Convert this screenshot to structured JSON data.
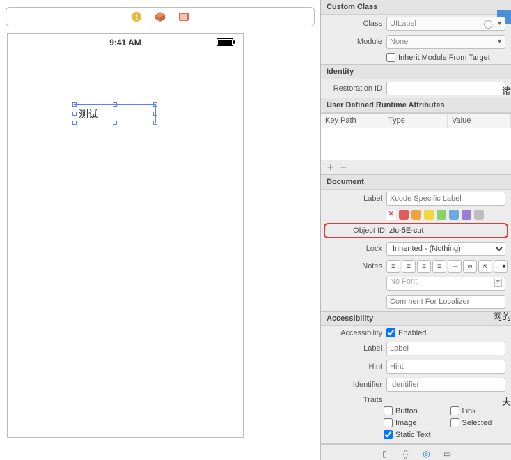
{
  "canvas": {
    "device_time": "9:41 AM",
    "selected_label_text": "测试"
  },
  "custom_class": {
    "header": "Custom Class",
    "class_label": "Class",
    "class_value": "UILabel",
    "module_label": "Module",
    "module_value": "None",
    "inherit_label": "Inherit Module From Target",
    "inherit_checked": false
  },
  "identity": {
    "header": "Identity",
    "restoration_label": "Restoration ID",
    "restoration_value": ""
  },
  "runtime_attrs": {
    "header": "User Defined Runtime Attributes",
    "columns": [
      "Key Path",
      "Type",
      "Value"
    ],
    "rows": []
  },
  "document": {
    "header": "Document",
    "label_label": "Label",
    "label_placeholder": "Xcode Specific Label",
    "swatches": [
      "none",
      "#e25b5b",
      "#f2a13d",
      "#f2d63d",
      "#8cd06a",
      "#6fa8dc",
      "#9b7fd4",
      "#bdbdbd"
    ],
    "object_id_label": "Object ID",
    "object_id_value": "zIc-5E-cut",
    "lock_label": "Lock",
    "lock_value": "Inherited - (Nothing)",
    "notes_label": "Notes",
    "no_font": "No Font",
    "comment_placeholder": "Comment For Localizer"
  },
  "accessibility": {
    "header": "Accessibility",
    "accessibility_label": "Accessibility",
    "enabled_label": "Enabled",
    "enabled_checked": true,
    "label_label": "Label",
    "label_placeholder": "Label",
    "hint_label": "Hint",
    "hint_placeholder": "Hint",
    "identifier_label": "Identifier",
    "identifier_placeholder": "Identifier",
    "traits_label": "Traits",
    "traits": {
      "button": {
        "label": "Button",
        "checked": false
      },
      "link": {
        "label": "Link",
        "checked": false
      },
      "image": {
        "label": "Image",
        "checked": false
      },
      "selected": {
        "label": "Selected",
        "checked": false
      },
      "static_text": {
        "label": "Static Text",
        "checked": true
      }
    }
  },
  "side_text": {
    "a": "诸",
    "b": "网的",
    "c": "夫"
  }
}
